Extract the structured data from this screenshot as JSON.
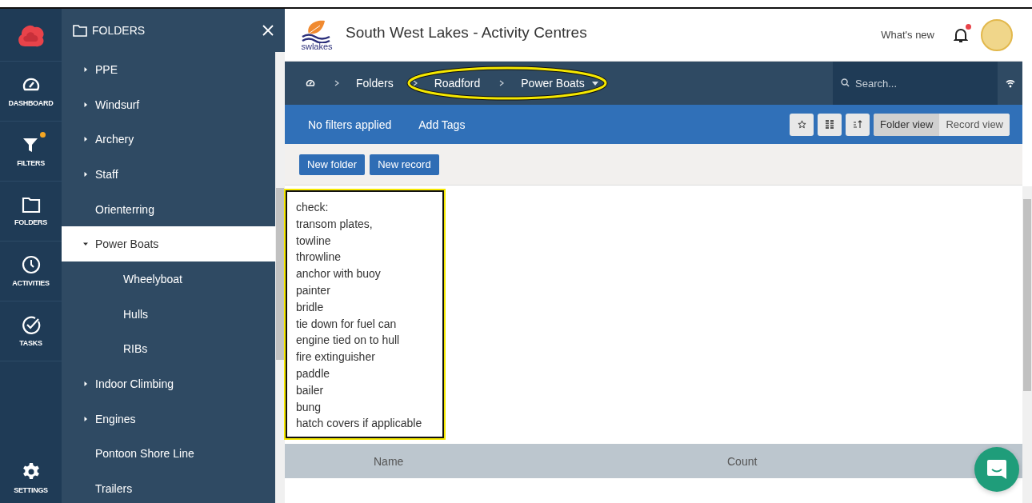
{
  "rail": {
    "items": [
      {
        "kind": "dashboard",
        "label": "DASHBOARD",
        "notification": false
      },
      {
        "kind": "filters",
        "label": "FILTERS",
        "notification": true
      },
      {
        "kind": "folders",
        "label": "FOLDERS",
        "notification": false
      },
      {
        "kind": "activities",
        "label": "ACTIVITIES",
        "notification": false
      },
      {
        "kind": "tasks",
        "label": "TASKS",
        "notification": false
      }
    ],
    "settings": {
      "label": "SETTINGS"
    }
  },
  "folders_panel": {
    "title": "FOLDERS",
    "items": [
      {
        "label": "PPE",
        "expandable": true,
        "expanded": false,
        "selected": false
      },
      {
        "label": "Windsurf",
        "expandable": true,
        "expanded": false,
        "selected": false
      },
      {
        "label": "Archery",
        "expandable": true,
        "expanded": false,
        "selected": false
      },
      {
        "label": "Staff",
        "expandable": true,
        "expanded": false,
        "selected": false
      },
      {
        "label": "Orienterring",
        "expandable": false,
        "selected": false
      },
      {
        "label": "Power Boats",
        "expandable": true,
        "expanded": true,
        "selected": true,
        "children": [
          {
            "label": "Wheelyboat",
            "expandable": false,
            "selected": false
          },
          {
            "label": "Hulls",
            "expandable": false,
            "selected": false
          },
          {
            "label": "RIBs",
            "expandable": false,
            "selected": false
          }
        ]
      },
      {
        "label": "Indoor Climbing",
        "expandable": true,
        "expanded": false,
        "selected": false
      },
      {
        "label": "Engines",
        "expandable": true,
        "expanded": false,
        "selected": false
      },
      {
        "label": "Pontoon Shore Line",
        "expandable": false,
        "selected": false
      },
      {
        "label": "Trailers",
        "expandable": false,
        "selected": false
      }
    ]
  },
  "header": {
    "logo_text": "swlakes",
    "title": "South West Lakes - Activity Centres",
    "whats_new": "What's new",
    "notification": true
  },
  "breadcrumb": {
    "items": [
      "Folders",
      "Roadford",
      "Power Boats"
    ],
    "search": {
      "placeholder": "Search..."
    }
  },
  "filter_bar": {
    "status": "No filters applied",
    "add_tags": "Add Tags",
    "views": [
      {
        "label": "Folder view",
        "selected": true
      },
      {
        "label": "Record view",
        "selected": false
      }
    ]
  },
  "toolbar": {
    "buttons": [
      "New folder",
      "New record"
    ]
  },
  "note": {
    "lines": [
      "check:",
      "transom plates,",
      "towline",
      "throwline",
      "anchor with buoy",
      "painter",
      "bridle",
      "tie down for fuel can",
      "engine tied on to hull",
      "fire extinguisher",
      "paddle",
      "bailer",
      "bung",
      "hatch covers if applicable"
    ]
  },
  "table": {
    "columns": [
      "Name",
      "Count"
    ]
  }
}
